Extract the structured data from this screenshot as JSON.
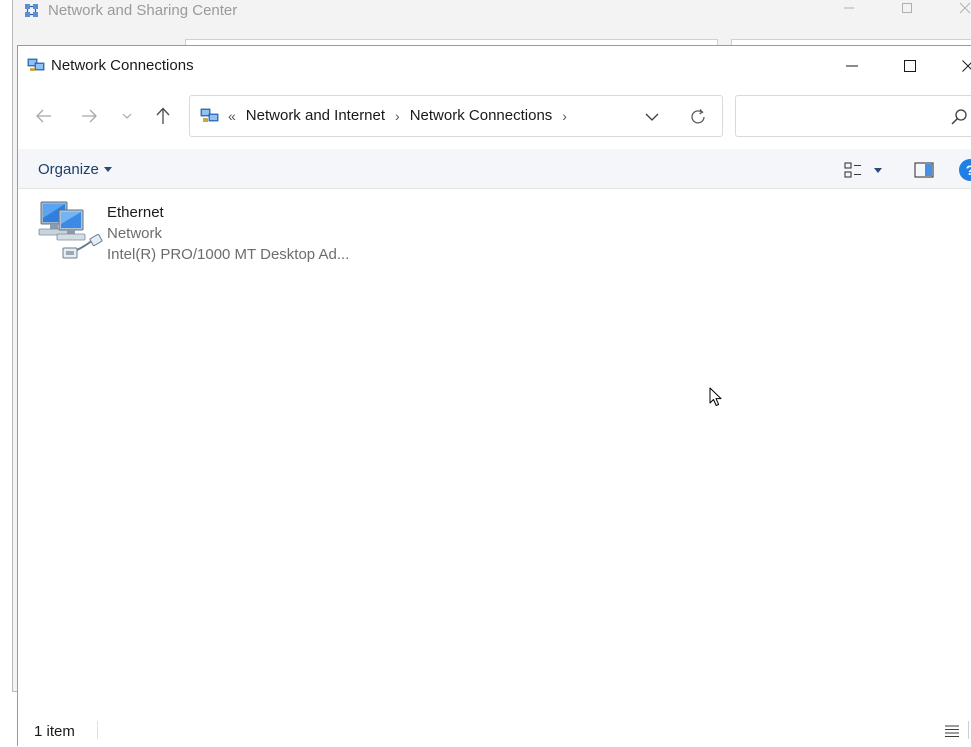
{
  "background_window": {
    "title": "Network and Sharing Center"
  },
  "window": {
    "title": "Network Connections"
  },
  "navigation": {
    "breadcrumb_overflow": "«",
    "breadcrumbs": [
      "Network and Internet",
      "Network Connections"
    ],
    "search_placeholder": ""
  },
  "commandbar": {
    "organize_label": "Organize",
    "help_label": "?"
  },
  "items": [
    {
      "name": "Ethernet",
      "status": "Network",
      "adapter": "Intel(R) PRO/1000 MT Desktop Ad..."
    }
  ],
  "statusbar": {
    "item_count": "1 item"
  },
  "colors": {
    "accent": "#1f7fe6",
    "link_text": "#1b3d6e"
  }
}
